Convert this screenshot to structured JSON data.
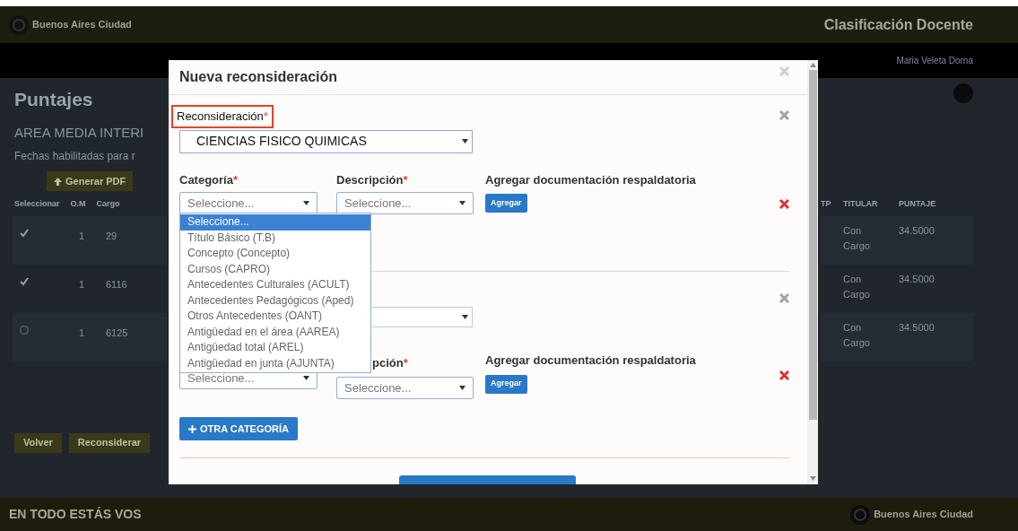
{
  "header": {
    "brand": "Buenos Aires Ciudad",
    "title": "Clasificación Docente"
  },
  "nav": {
    "user": "Maria Veleta Dorna"
  },
  "page": {
    "title": "Puntajes",
    "area": "AREA MEDIA INTERI",
    "dates": "Fechas habilitadas para r",
    "pdf_button": "Generar PDF",
    "columns_left": [
      "Seleccionar",
      "O.M",
      "Cargo"
    ],
    "columns_right": [
      "TP",
      "TITULAR",
      "PUNTAJE"
    ],
    "rows": [
      {
        "checked": true,
        "om": "1",
        "cargo": "29",
        "titular": "Con Cargo",
        "puntaje": "34.5000"
      },
      {
        "checked": true,
        "om": "1",
        "cargo": "6116",
        "titular": "Con Cargo",
        "puntaje": "34.5000"
      },
      {
        "checked": false,
        "om": "1",
        "cargo": "6125",
        "titular": "Con Cargo",
        "puntaje": "34.5000"
      }
    ],
    "buttons": [
      "Volver",
      "Reconsiderar"
    ]
  },
  "modal": {
    "title": "Nueva reconsideración",
    "reconsideracion": {
      "label": "Reconsideración",
      "mark": "*",
      "highlighted": true,
      "value": "CIENCIAS FISICO QUIMICAS"
    },
    "row1": {
      "category_label": "Categoría",
      "description_label": "Descripción",
      "mark": "*",
      "docs_label": "Agregar documentación respaldatoria",
      "category_value": "Seleccione...",
      "description_value": "Seleccione...",
      "add_button": "Agregar"
    },
    "dropdown": [
      {
        "label": "Seleccione...",
        "selected": true
      },
      {
        "label": "Título Básico (T.B)",
        "selected": false
      },
      {
        "label": "Concepto (Concepto)",
        "selected": false
      },
      {
        "label": "Cursos (CAPRO)",
        "selected": false
      },
      {
        "label": "Antecedentes Culturales (ACULT)",
        "selected": false
      },
      {
        "label": "Antecedentes Pedagógicos (Aped)",
        "selected": false
      },
      {
        "label": "Otros Antecedentes (OANT)",
        "selected": false
      },
      {
        "label": "Antigüedad en el área (AAREA)",
        "selected": false
      },
      {
        "label": "Antigüedad total (AREL)",
        "selected": false
      },
      {
        "label": "Antigüedad en junta (AJUNTA)",
        "selected": false
      }
    ],
    "row2": {
      "description_label": "pción",
      "mark": "*",
      "docs_label": "Agregar documentación respaldatoria",
      "category_value": "Seleccione...",
      "description_value": "Seleccione...",
      "add_button": "Agregar"
    },
    "add_category": "OTRA CATEGORÍA"
  },
  "footer": {
    "slogan": "EN TODO ESTÁS VOS",
    "brand": "Buenos Aires Ciudad"
  }
}
